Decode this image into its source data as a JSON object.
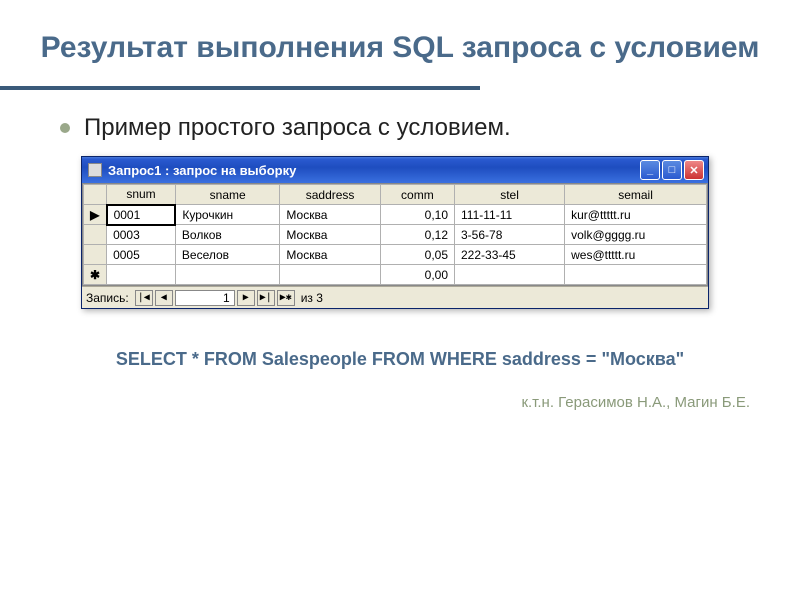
{
  "slide": {
    "title": "Результат выполнения SQL запроса с условием",
    "bullet": "Пример простого запроса с условием.",
    "sql": "SELECT * FROM Salespeople FROM WHERE saddress = \"Москва\"",
    "footer": "к.т.н. Герасимов Н.А., Магин Б.Е."
  },
  "window": {
    "title": "Запрос1 : запрос на выборку",
    "columns": [
      "snum",
      "sname",
      "saddress",
      "comm",
      "stel",
      "semail"
    ],
    "rows": [
      {
        "sel": "▶",
        "snum": "0001",
        "sname": "Курочкин",
        "saddress": "Москва",
        "comm": "0,10",
        "stel": "111-11-11",
        "semail": "kur@ttttt.ru"
      },
      {
        "sel": "",
        "snum": "0003",
        "sname": "Волков",
        "saddress": "Москва",
        "comm": "0,12",
        "stel": "3-56-78",
        "semail": "volk@gggg.ru"
      },
      {
        "sel": "",
        "snum": "0005",
        "sname": "Веселов",
        "saddress": "Москва",
        "comm": "0,05",
        "stel": "222-33-45",
        "semail": "wes@ttttt.ru"
      },
      {
        "sel": "✱",
        "snum": "",
        "sname": "",
        "saddress": "",
        "comm": "0,00",
        "stel": "",
        "semail": ""
      }
    ],
    "nav": {
      "label": "Запись:",
      "first": "|◀",
      "prev": "◀",
      "value": "1",
      "next": "▶",
      "last": "▶|",
      "new": "▶✱",
      "count": "из 3"
    }
  }
}
